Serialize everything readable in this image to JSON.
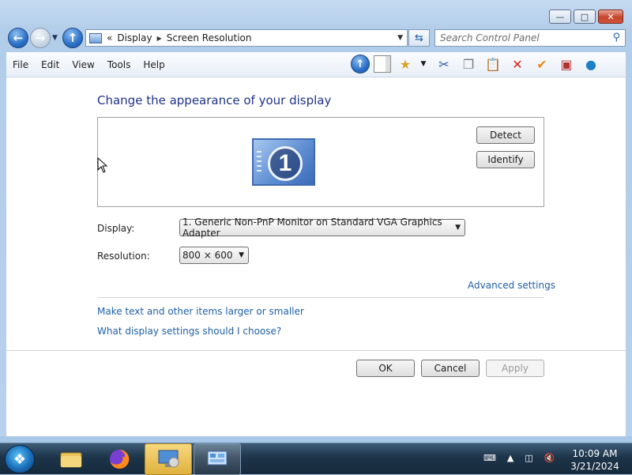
{
  "window": {
    "minimize_icon": "minimize-icon",
    "maximize_icon": "maximize-icon",
    "close_icon": "close-icon"
  },
  "nav": {
    "back_icon": "back-arrow-icon",
    "forward_icon": "forward-arrow-icon",
    "up_icon": "up-arrow-icon"
  },
  "address": {
    "chevrons": "«",
    "crumbs": [
      "Display",
      "Screen Resolution"
    ]
  },
  "search": {
    "placeholder": "Search Control Panel"
  },
  "menu": [
    "File",
    "Edit",
    "View",
    "Tools",
    "Help"
  ],
  "page": {
    "heading": "Change the appearance of your display",
    "monitor_number": "1",
    "detect_label": "Detect",
    "identify_label": "Identify",
    "display_label": "Display:",
    "display_value": "1. Generic Non-PnP Monitor on Standard VGA Graphics Adapter",
    "resolution_label": "Resolution:",
    "resolution_value": "800 × 600",
    "advanced_link": "Advanced settings",
    "link_text_size": "Make text and other items larger or smaller",
    "link_choose": "What display settings should I choose?",
    "ok_label": "OK",
    "cancel_label": "Cancel",
    "apply_label": "Apply"
  },
  "taskbar": {
    "time": "10:09 AM",
    "date": "3/21/2024"
  }
}
